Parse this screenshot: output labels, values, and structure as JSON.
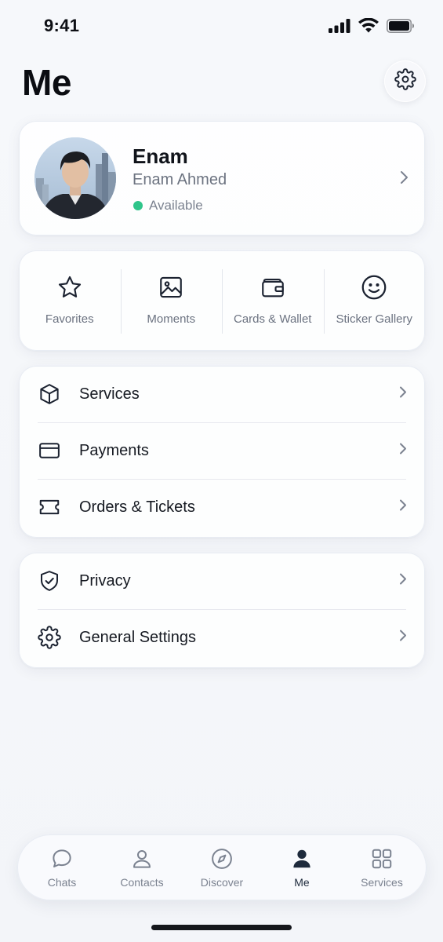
{
  "status_bar": {
    "time": "9:41"
  },
  "header": {
    "title": "Me"
  },
  "profile": {
    "name": "Enam",
    "full_name": "Enam Ahmed",
    "status": "Available",
    "status_color": "#2fc58a"
  },
  "quick_actions": [
    {
      "label": "Favorites",
      "icon": "star-icon"
    },
    {
      "label": "Moments",
      "icon": "image-icon"
    },
    {
      "label": "Cards & Wallet",
      "icon": "wallet-icon"
    },
    {
      "label": "Sticker Gallery",
      "icon": "smiley-icon"
    }
  ],
  "menu_group_1": [
    {
      "label": "Services",
      "icon": "box-icon"
    },
    {
      "label": "Payments",
      "icon": "card-icon"
    },
    {
      "label": "Orders & Tickets",
      "icon": "ticket-icon"
    }
  ],
  "menu_group_2": [
    {
      "label": "Privacy",
      "icon": "shield-check-icon"
    },
    {
      "label": "General Settings",
      "icon": "gear-icon"
    }
  ],
  "tab_bar": {
    "active": "Me",
    "tabs": [
      {
        "label": "Chats",
        "icon": "chat-bubble-icon"
      },
      {
        "label": "Contacts",
        "icon": "contacts-icon"
      },
      {
        "label": "Discover",
        "icon": "compass-icon"
      },
      {
        "label": "Me",
        "icon": "person-icon"
      },
      {
        "label": "Services",
        "icon": "grid-icon"
      }
    ]
  },
  "colors": {
    "background": "#f4f6fa",
    "text_primary": "#161a22",
    "text_secondary": "#6c7380",
    "active_tab": "#1e2a3c"
  }
}
